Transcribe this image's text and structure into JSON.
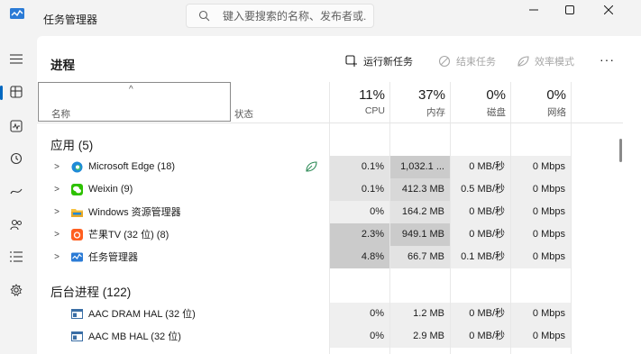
{
  "window": {
    "title": "任务管理器",
    "search_placeholder": "键入要搜索的名称、发布者或...",
    "minimize_glyph": "—",
    "maximize_glyph": "☐",
    "close_glyph": "✕"
  },
  "nav": {
    "hamburger_icon": "menu-icon",
    "items": [
      {
        "name": "processes",
        "icon": "processes-icon",
        "active": true
      },
      {
        "name": "performance",
        "icon": "performance-icon"
      },
      {
        "name": "app-history",
        "icon": "history-icon"
      },
      {
        "name": "startup-apps",
        "icon": "startup-icon"
      },
      {
        "name": "users",
        "icon": "users-icon"
      },
      {
        "name": "details",
        "icon": "details-icon"
      },
      {
        "name": "services",
        "icon": "services-icon"
      }
    ]
  },
  "page": {
    "title": "进程",
    "run_new_task": "运行新任务",
    "end_task": "结束任务",
    "efficiency_mode": "效率模式",
    "more": "···"
  },
  "columns": {
    "sort_arrow": "^",
    "name": "名称",
    "status": "状态",
    "cpu": {
      "pct": "11%",
      "label": "CPU"
    },
    "memory": {
      "pct": "37%",
      "label": "内存"
    },
    "disk": {
      "pct": "0%",
      "label": "磁盘"
    },
    "network": {
      "pct": "0%",
      "label": "网络"
    }
  },
  "groups": {
    "apps": {
      "title": "应用 (5)",
      "rows": [
        {
          "name": "Microsoft Edge (18)",
          "icon": "edge-icon",
          "status_icon": "efficiency-leaf-icon",
          "cpu": "0.1%",
          "memory": "1,032.1 ...",
          "disk": "0 MB/秒",
          "network": "0 Mbps"
        },
        {
          "name": "Weixin (9)",
          "icon": "wechat-icon",
          "cpu": "0.1%",
          "memory": "412.3 MB",
          "disk": "0.5 MB/秒",
          "network": "0 Mbps"
        },
        {
          "name": "Windows 资源管理器",
          "icon": "folder-icon",
          "cpu": "0%",
          "memory": "164.2 MB",
          "disk": "0 MB/秒",
          "network": "0 Mbps"
        },
        {
          "name": "芒果TV (32 位) (8)",
          "icon": "mangotv-icon",
          "cpu": "2.3%",
          "memory": "949.1 MB",
          "disk": "0 MB/秒",
          "network": "0 Mbps"
        },
        {
          "name": "任务管理器",
          "icon": "task-manager-icon",
          "cpu": "4.8%",
          "memory": "66.7 MB",
          "disk": "0.1 MB/秒",
          "network": "0 Mbps"
        }
      ]
    },
    "background": {
      "title": "后台进程 (122)",
      "rows": [
        {
          "name": "AAC DRAM HAL (32 位)",
          "icon": "app-window-icon",
          "cpu": "0%",
          "memory": "1.2 MB",
          "disk": "0 MB/秒",
          "network": "0 Mbps"
        },
        {
          "name": "AAC MB HAL (32 位)",
          "icon": "app-window-icon",
          "cpu": "0%",
          "memory": "2.9 MB",
          "disk": "0 MB/秒",
          "network": "0 Mbps"
        }
      ]
    }
  },
  "colors": {
    "accent": "#0067c0",
    "heat_light": "#f0f0f0",
    "heat_mid": "#dcdcdc",
    "heat_dark": "#c8c8c8"
  }
}
